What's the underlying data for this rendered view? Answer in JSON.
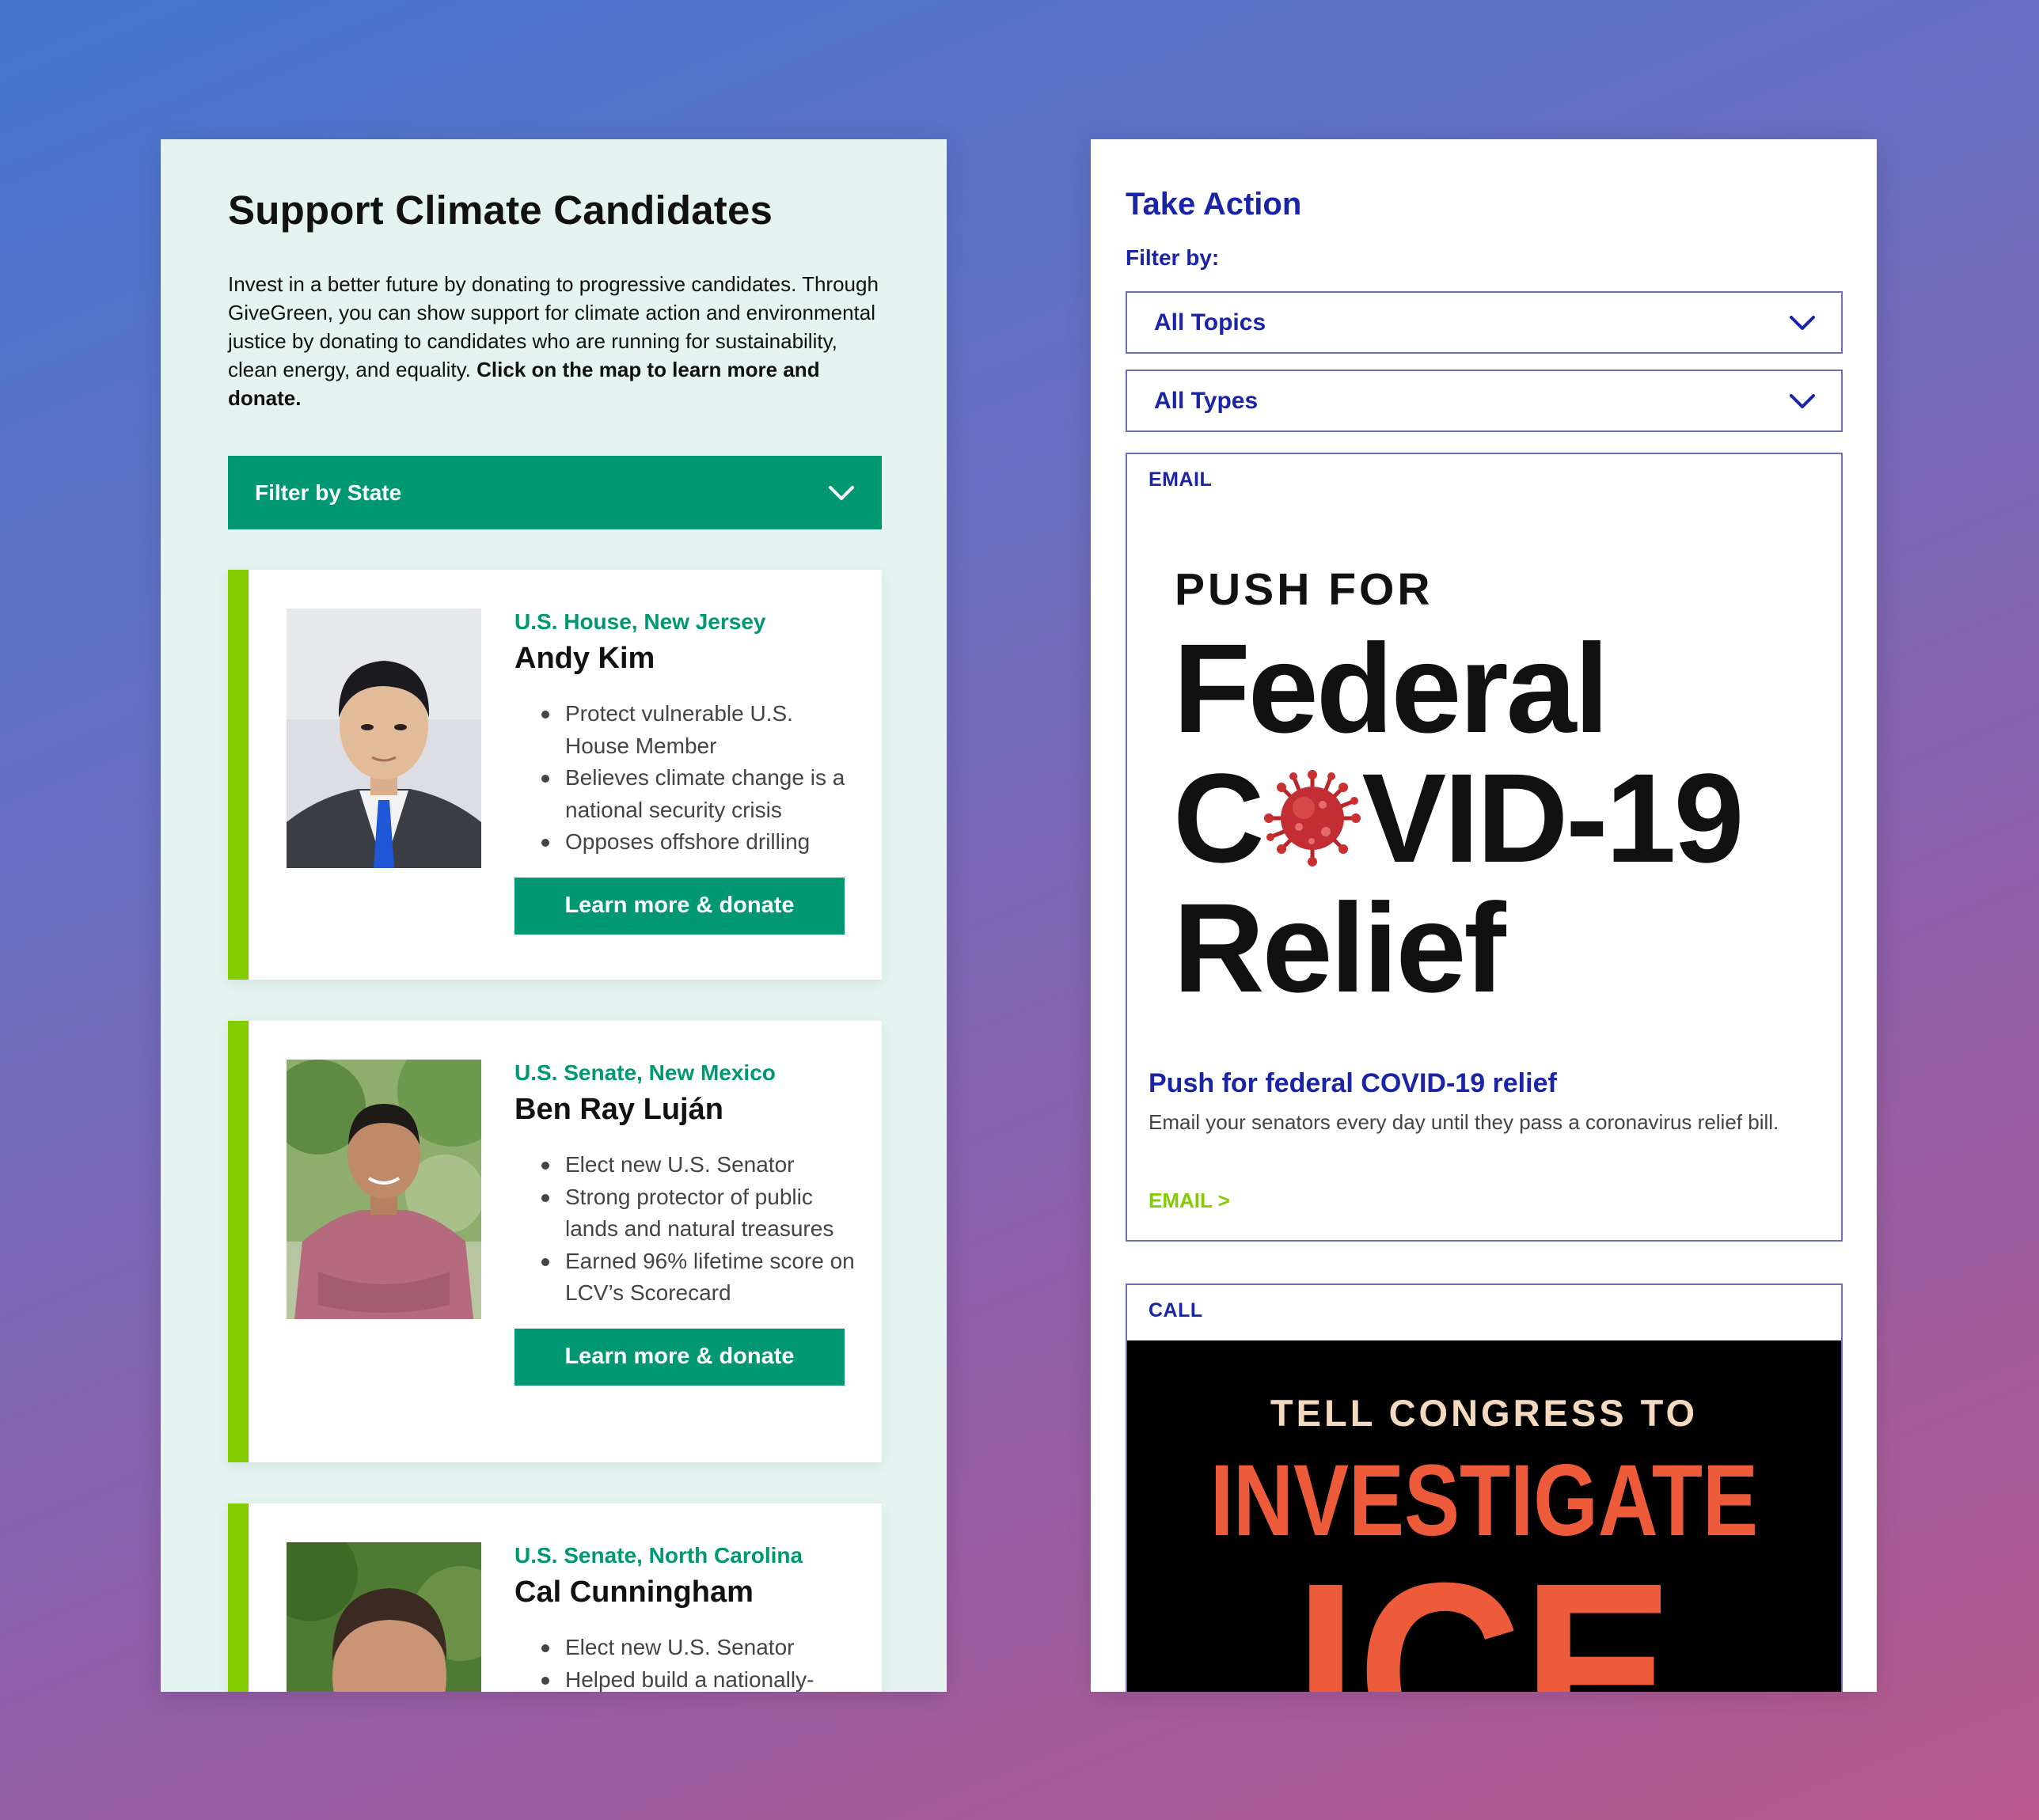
{
  "colors": {
    "brand_green": "#009872",
    "accent_lime": "#82cc00",
    "brand_blue": "#1a24a6",
    "panel_mint": "#e5f4f0",
    "ice_orange": "#ee5b3a"
  },
  "candidates_page": {
    "title": "Support Climate Candidates",
    "intro": "Invest in a better future by donating to progressive candidates. Through GiveGreen, you can show support for climate action and environmental justice by donating to candidates who are running for sustainability, clean energy, and equality.",
    "intro_bold": "Click on the map to learn more and donate.",
    "filter_label": "Filter by State",
    "filter_icon": "chevron-down-icon",
    "candidates": [
      {
        "race": "U.S. House, New Jersey",
        "name": "Andy Kim",
        "points": [
          "Protect vulnerable U.S. House Member",
          "Believes climate change is a national security crisis",
          "Opposes offshore drilling"
        ],
        "button": "Learn more & donate"
      },
      {
        "race": "U.S. Senate, New Mexico",
        "name": "Ben Ray Luján",
        "points": [
          "Elect new U.S. Senator",
          "Strong protector of public lands and natural treasures",
          "Earned 96% lifetime score on LCV’s Scorecard"
        ],
        "button": "Learn more & donate"
      },
      {
        "race": "U.S. Senate, North Carolina",
        "name": "Cal Cunningham",
        "points": [
          "Elect new U.S. Senator",
          "Helped build a nationally-"
        ],
        "button": ""
      }
    ]
  },
  "actions_page": {
    "title": "Take Action",
    "filter_by": "Filter by:",
    "selects": [
      {
        "value": "All Topics",
        "icon": "chevron-down-icon"
      },
      {
        "value": "All Types",
        "icon": "chevron-down-icon"
      }
    ],
    "cards": [
      {
        "type": "EMAIL",
        "hero": {
          "kicker": "PUSH FOR",
          "line1": "Federal",
          "line2_pre": "C",
          "line2_post": "VID-19",
          "line3": "Relief",
          "icon": "coronavirus-icon"
        },
        "headline": "Push for federal COVID-19 relief",
        "description": "Email your senators every day until they pass a coronavirus relief bill.",
        "link": "EMAIL >"
      },
      {
        "type": "CALL",
        "hero": {
          "kicker": "TELL CONGRESS TO",
          "line1": "INVESTIGATE",
          "line2": "ICE"
        }
      }
    ]
  }
}
